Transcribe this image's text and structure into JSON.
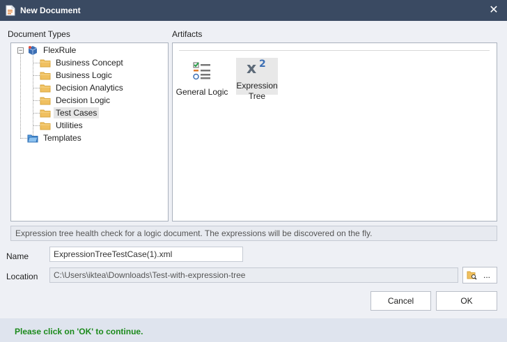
{
  "window": {
    "title": "New Document",
    "close_label": "✕"
  },
  "document_types": {
    "label": "Document Types",
    "root": {
      "label": "FlexRule",
      "expander": "−"
    },
    "items": [
      {
        "label": "Business Concept"
      },
      {
        "label": "Business Logic"
      },
      {
        "label": "Decision Analytics"
      },
      {
        "label": "Decision Logic"
      },
      {
        "label": "Test Cases",
        "selected": true
      },
      {
        "label": "Utilities"
      }
    ],
    "templates": {
      "label": "Templates"
    }
  },
  "artifacts": {
    "label": "Artifacts",
    "items": [
      {
        "label": "General Logic",
        "icon": "checklist-icon"
      },
      {
        "label_line1": "Expression",
        "label_line2": "Tree",
        "icon": "superscript-x-icon",
        "glyph": "x",
        "superscript": "2",
        "selected": true
      }
    ]
  },
  "description": "Expression tree health check for a logic document. The expressions will be discovered on the fly.",
  "form": {
    "name_label": "Name",
    "name_value": "ExpressionTreeTestCase(1).xml",
    "location_label": "Location",
    "location_value": "C:\\Users\\iktea\\Downloads\\Test-with-expression-tree",
    "browse_label": "...",
    "browse_icon": "folder-search-icon"
  },
  "buttons": {
    "cancel": "Cancel",
    "ok": "OK"
  },
  "footer": {
    "message": "Please click on 'OK' to continue."
  },
  "colors": {
    "titlebar": "#3a4a62",
    "folder": "#f0c060",
    "accent_blue": "#3c6fb4",
    "message_green": "#1c8a1c"
  }
}
